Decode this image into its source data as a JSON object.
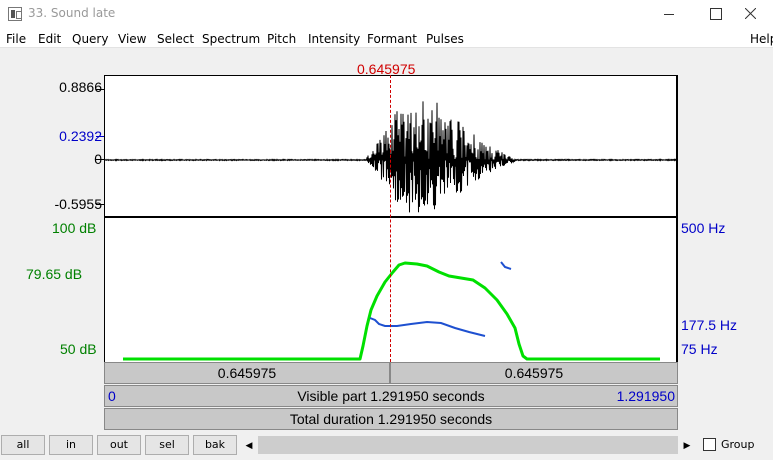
{
  "window": {
    "title": "33. Sound late",
    "minimize_icon": "minimize-icon",
    "maximize_icon": "maximize-icon",
    "close_icon": "close-icon"
  },
  "menu": [
    "File",
    "Edit",
    "Query",
    "View",
    "Select",
    "Spectrum",
    "Pitch",
    "Intensity",
    "Formant",
    "Pulses",
    "Help"
  ],
  "cursor": {
    "time": "0.645975",
    "color": "#d00000"
  },
  "waveform": {
    "max_label": "0.8866",
    "cursor_amp_label": "0.2392",
    "zero_label": "0",
    "min_label": "-0.5955"
  },
  "analysis": {
    "intensity_top": "100 dB",
    "intensity_cursor": "79.65 dB",
    "intensity_bottom": "50 dB",
    "pitch_top": "500 Hz",
    "pitch_cursor": "177.5 Hz",
    "pitch_bottom": "75 Hz",
    "intensity_color": "#00e000",
    "pitch_color": "#1e50d0"
  },
  "selection": {
    "left_duration": "0.645975",
    "right_duration": "0.645975"
  },
  "visible": {
    "start": "0",
    "label": "Visible part 1.291950 seconds",
    "end": "1.291950"
  },
  "total": {
    "label": "Total duration 1.291950 seconds"
  },
  "buttons": [
    "all",
    "in",
    "out",
    "sel",
    "bak"
  ],
  "scrollbar": {
    "left_icon": "scroll-left-icon",
    "right_icon": "scroll-right-icon"
  },
  "group": {
    "label": "Group",
    "checked": false
  }
}
